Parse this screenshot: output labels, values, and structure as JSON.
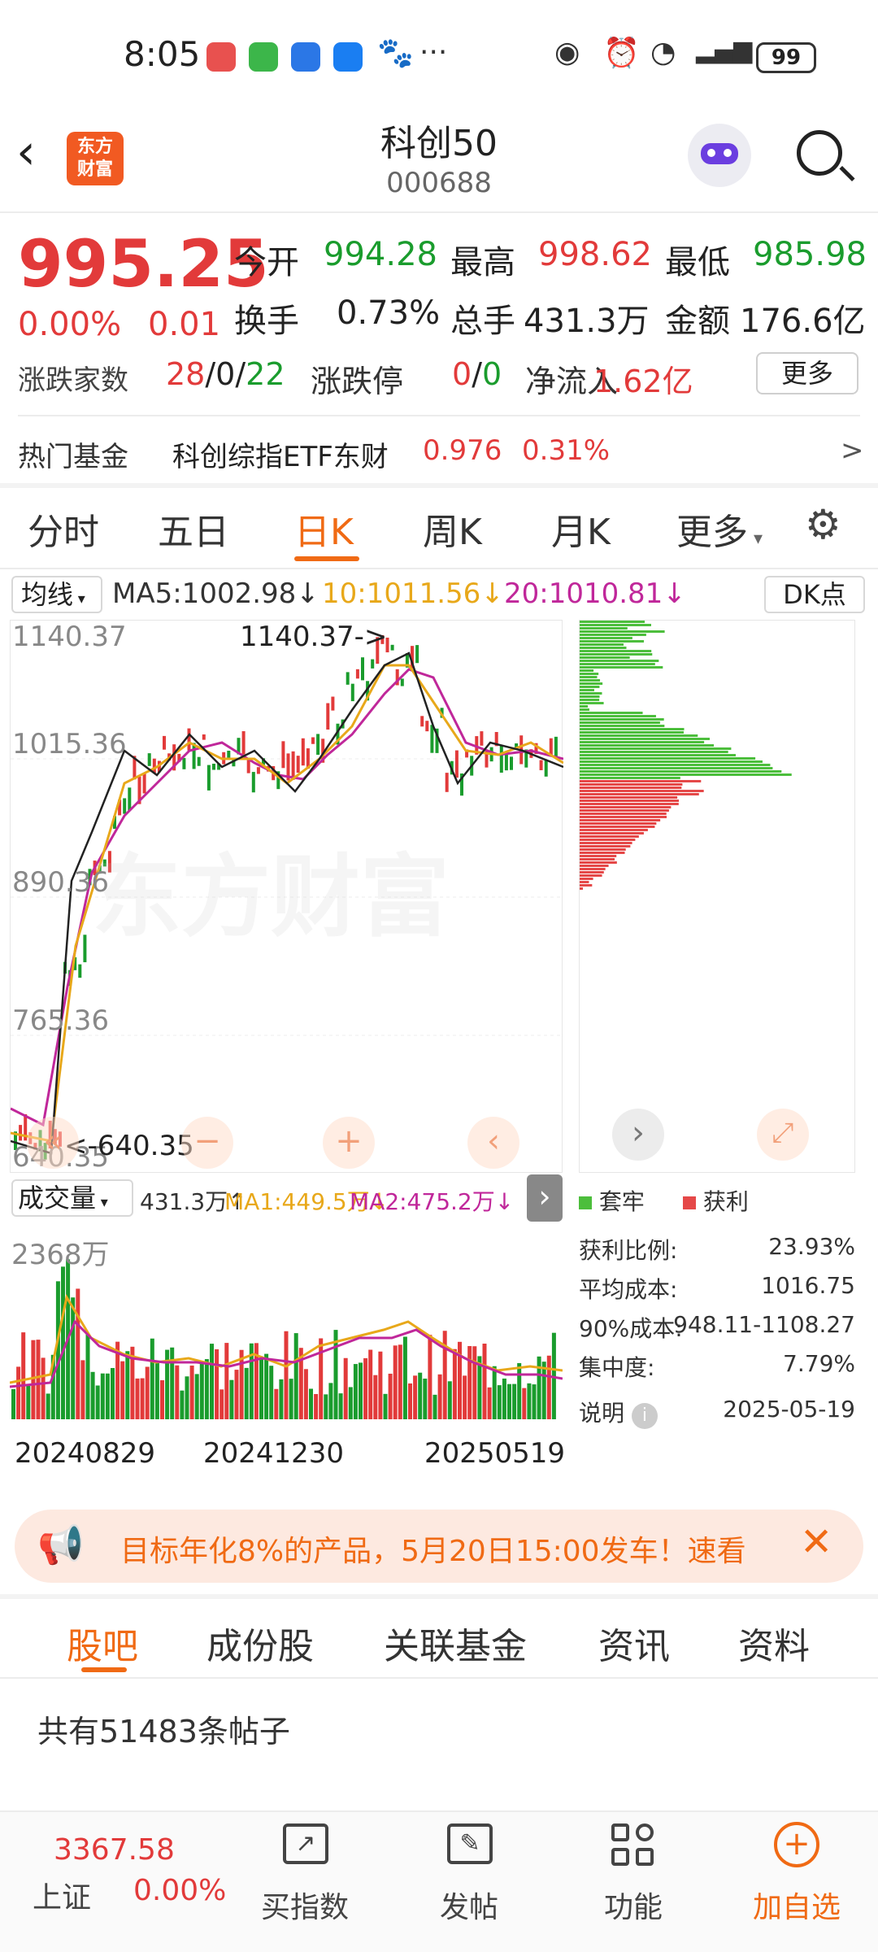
{
  "status": {
    "time": "8:05",
    "battery": "99",
    "more": "···"
  },
  "header": {
    "title": "科创50",
    "code": "000688",
    "logo_line1": "东方",
    "logo_line2": "财富"
  },
  "quote": {
    "price": "995.25",
    "change_pct": "0.00%",
    "change": "0.01",
    "open_label": "今开",
    "open": "994.28",
    "high_label": "最高",
    "high": "998.62",
    "low_label": "最低",
    "low": "985.98",
    "turnover_label": "换手",
    "turnover": "0.73%",
    "volume_label": "总手",
    "volume": "431.3万",
    "amount_label": "金额",
    "amount": "176.6亿",
    "updown_label": "涨跌家数",
    "up": "28",
    "flat": "0",
    "down": "22",
    "limit_label": "涨跌停",
    "limit_up": "0",
    "limit_down": "0",
    "inflow_label": "净流入",
    "inflow": "1.62亿",
    "more_button": "更多"
  },
  "hot_fund": {
    "label": "热门基金",
    "name": "科创综指ETF东财",
    "price": "0.976",
    "pct": "0.31%",
    "arrow": ">"
  },
  "tabs": [
    "分时",
    "五日",
    "日K",
    "周K",
    "月K",
    "更多"
  ],
  "active_tab": "日K",
  "ma_bar": {
    "selector": "均线",
    "ma5": "MA5:1002.98",
    "ma10": "10:1011.56",
    "ma20": "20:1010.81",
    "dk": "DK点"
  },
  "k_axis": {
    "y1": "1140.37",
    "y2": "1015.36",
    "y3": "890.36",
    "y4": "765.36",
    "y5": "640.35",
    "max_label": "1140.37->",
    "min_label": "<-640.35"
  },
  "watermark": "东方财富",
  "vol_bar": {
    "selector": "成交量",
    "vol": "431.3万↑",
    "ma1": "MA1:449.5万↓",
    "ma2": "MA2:475.2万↓",
    "max": "2368万"
  },
  "dates": [
    "20240829",
    "20241230",
    "20250519"
  ],
  "chip": {
    "legend_trap": "套牢",
    "legend_profit": "获利",
    "rows": [
      {
        "label": "获利比例:",
        "value": "23.93%"
      },
      {
        "label": "平均成本:",
        "value": "1016.75"
      },
      {
        "label": "90%成本:",
        "value": "948.11-1108.27"
      },
      {
        "label": "集中度:",
        "value": "7.79%"
      }
    ],
    "note_label": "说明",
    "date": "2025-05-19"
  },
  "banner": {
    "text": "目标年化8%的产品，5月20日15:00发车！速看"
  },
  "bottom_tabs": [
    "股吧",
    "成份股",
    "关联基金",
    "资讯",
    "资料"
  ],
  "forum": {
    "count_text": "共有51483条帖子"
  },
  "nav": {
    "index_value": "3367.58",
    "index_name": "上证",
    "index_pct": "0.00%",
    "buy_index": "买指数",
    "post": "发帖",
    "function": "功能",
    "add_watch": "加自选"
  },
  "colors": {
    "up": "#e23a3a",
    "down": "#1a9c2d",
    "accent": "#f06a14"
  }
}
